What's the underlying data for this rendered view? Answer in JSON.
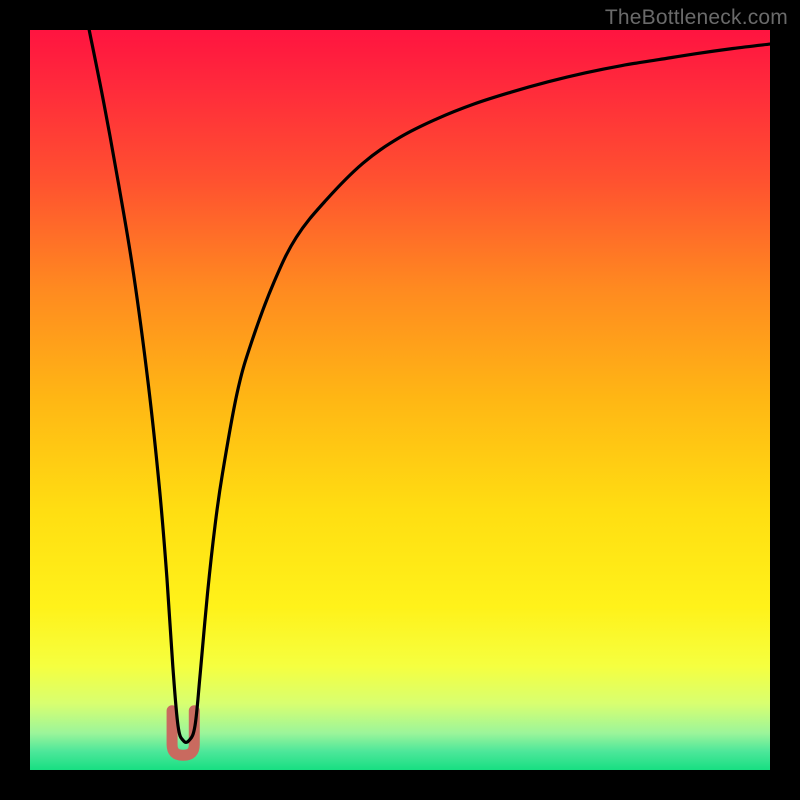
{
  "watermark": "TheBottleneck.com",
  "gradient": {
    "stops": [
      {
        "offset": 0.0,
        "color": "#ff1440"
      },
      {
        "offset": 0.08,
        "color": "#ff2b3b"
      },
      {
        "offset": 0.2,
        "color": "#ff5030"
      },
      {
        "offset": 0.35,
        "color": "#ff8a20"
      },
      {
        "offset": 0.5,
        "color": "#ffb714"
      },
      {
        "offset": 0.65,
        "color": "#ffde12"
      },
      {
        "offset": 0.78,
        "color": "#fff21a"
      },
      {
        "offset": 0.86,
        "color": "#f5ff40"
      },
      {
        "offset": 0.91,
        "color": "#d8ff70"
      },
      {
        "offset": 0.95,
        "color": "#9cf59a"
      },
      {
        "offset": 0.975,
        "color": "#4de79a"
      },
      {
        "offset": 1.0,
        "color": "#17df82"
      }
    ]
  },
  "chart_data": {
    "type": "line",
    "title": "",
    "xlabel": "",
    "ylabel": "",
    "xlim": [
      0,
      100
    ],
    "ylim": [
      0,
      100
    ],
    "series": [
      {
        "name": "bottleneck-curve",
        "x": [
          8,
          10,
          12,
          14,
          16,
          17.5,
          18.5,
          19.3,
          20,
          20.7,
          21.5,
          22.3,
          23,
          24,
          25,
          26,
          28,
          30,
          33,
          36,
          40,
          45,
          50,
          55,
          60,
          65,
          70,
          75,
          80,
          85,
          90,
          95,
          100
        ],
        "y": [
          100,
          90,
          79,
          67,
          52,
          38,
          26,
          14,
          6,
          4,
          4,
          6,
          13,
          24,
          33,
          40,
          51,
          58,
          66,
          72,
          77,
          82,
          85.5,
          88,
          90,
          91.6,
          93,
          94.2,
          95.2,
          96,
          96.8,
          97.5,
          98.1
        ]
      }
    ],
    "marker": {
      "name": "curve-minimum-marker",
      "x_range": [
        19.2,
        22.2
      ],
      "y_range": [
        2.0,
        8.0
      ],
      "color": "#c96a5f"
    },
    "notes": "y represents bottleneck percentage (0 at bottom = no bottleneck / green, 100 at top = full bottleneck / red). Curve dips to ~4% near x≈20-21 then rises asymptotically."
  }
}
